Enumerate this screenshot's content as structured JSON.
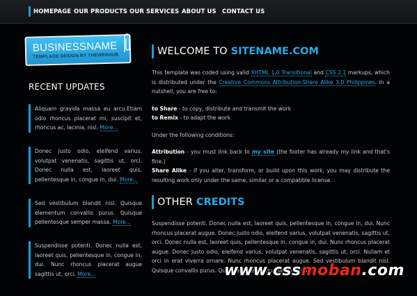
{
  "nav": {
    "items": [
      "HOMEPAGE",
      "OUR PRODUCTS",
      "OUR SERVICES",
      "ABOUT US",
      "CONTACT US"
    ]
  },
  "logo": {
    "title": "BUSINESSNAME",
    "subtitle": "TEMPLAGE DESIGN BY THEWEBHUB"
  },
  "sidebar": {
    "heading": "RECENT UPDATES",
    "updates": [
      {
        "text": "Aliquam gravida massa eu arcu.Etiam odio rhoncus placerat mi, suscipit et, rhoncus ac, lacinia, nisl. ",
        "more": "More..."
      },
      {
        "text": "Donec justo odio, eleifend varius, volutpat venenatis, sagittis ut, orci. Donec nulla est, laoreet quis, pellentesque in, congue in, dui. ",
        "more": "More..."
      },
      {
        "text": "Sed vestibulum blandit nisl. Quisque elementum convallis purus. Quisque pellentesque semper massa. ",
        "more": "More..."
      },
      {
        "text": "Suspendisse potenti. Donec nulla est, laoreet quis, pellentesque in, congue in, dui. Nunc rhoncus placerat augue sagittis ut, orci. ",
        "more": "More..."
      }
    ]
  },
  "welcome": {
    "heading_white": "WELCOME TO",
    "heading_blue": "SITENAME.COM",
    "intro_1": "This template was coded using valid ",
    "link_xhtml": "XHTML 1.0 Transitional",
    "intro_and": " and ",
    "link_css": "CSS 2.1",
    "intro_2": " markups, which is distributed under the ",
    "link_license": "Creative Commons Attribution-Share Alike 3.0 Philippines",
    "intro_3": ". In a nutshell, you are free to:",
    "share_label": "to Share",
    "share_text": " - to copy, distribute and transmit the work",
    "remix_label": "to Remix",
    "remix_text": " - to adapt the work",
    "conditions": "Under the following conditions:",
    "attribution_label": "Attribution",
    "attribution_text_1": " - you must link back to ",
    "attribution_link": "my site",
    "attribution_text_2": " (the footer has already my link and that's fine.)",
    "sharealike_label": "Share Alike",
    "sharealike_text": " - if you alter, transform, or build upon this work, you may distribute the resulting work only under the same, similar or a compatible license."
  },
  "credits": {
    "heading_white": "OTHER",
    "heading_blue": "CREDITS",
    "text": "Suspendisse potenti. Donec nulla est, laoreet quis, pellentesque in, congue in, dui. Nunc rhoncus placerat augue. Donec justo odio, eleifend varius, volutpat venenatis, sagittis ut, orci. Donec nulla est, laoreet quis, pellentesque in, congue in, dui. Nunc rhoncus placerat augue. Donec justo odio, eleifend varius, volutpat venenatis, sagittis ut, orci. Nullam et orci in erat viverra ornare. Nunc rhoncus placerat augue. Sed vestibulum blandit nisl. Quisque convallis purus. Quisque pellentesque semper massa."
  },
  "watermark": {
    "prefix": "www.css",
    "middle": "moban",
    "suffix": ".com"
  },
  "colors": {
    "accent": "#1f9bd8",
    "link": "#2ba9e6",
    "background": "#020304",
    "watermark_red": "#e8291c"
  }
}
